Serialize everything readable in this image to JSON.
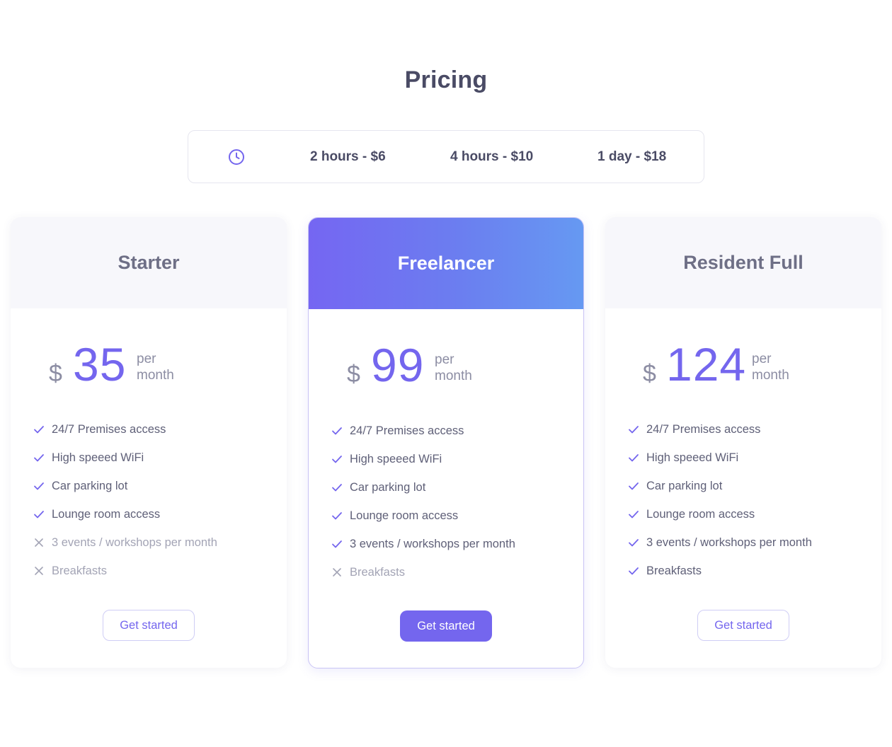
{
  "page": {
    "title": "Pricing"
  },
  "rates": {
    "icon": "clock-icon",
    "items": [
      "2 hours - $6",
      "4 hours - $10",
      "1 day - $18"
    ]
  },
  "colors": {
    "accent": "#7466ee",
    "gradient_end": "#6699f2",
    "muted": "#a3a4b5"
  },
  "plans": [
    {
      "name": "Starter",
      "currency": "$",
      "price": "35",
      "per_line1": "per",
      "per_line2": "month",
      "features": [
        {
          "label": "24/7 Premises access",
          "included": true
        },
        {
          "label": "High speeed WiFi",
          "included": true
        },
        {
          "label": "Car parking lot",
          "included": true
        },
        {
          "label": "Lounge room access",
          "included": true
        },
        {
          "label": "3 events / workshops per month",
          "included": false
        },
        {
          "label": "Breakfasts",
          "included": false
        }
      ],
      "cta": "Get started",
      "highlighted": false
    },
    {
      "name": "Freelancer",
      "currency": "$",
      "price": "99",
      "per_line1": "per",
      "per_line2": "month",
      "features": [
        {
          "label": "24/7 Premises access",
          "included": true
        },
        {
          "label": "High speeed WiFi",
          "included": true
        },
        {
          "label": "Car parking lot",
          "included": true
        },
        {
          "label": "Lounge room access",
          "included": true
        },
        {
          "label": "3 events / workshops per month",
          "included": true
        },
        {
          "label": "Breakfasts",
          "included": false
        }
      ],
      "cta": "Get started",
      "highlighted": true
    },
    {
      "name": "Resident Full",
      "currency": "$",
      "price": "124",
      "per_line1": "per",
      "per_line2": "month",
      "features": [
        {
          "label": "24/7 Premises access",
          "included": true
        },
        {
          "label": "High speeed WiFi",
          "included": true
        },
        {
          "label": "Car parking lot",
          "included": true
        },
        {
          "label": "Lounge room access",
          "included": true
        },
        {
          "label": "3 events / workshops per month",
          "included": true
        },
        {
          "label": "Breakfasts",
          "included": true
        }
      ],
      "cta": "Get started",
      "highlighted": false
    }
  ]
}
